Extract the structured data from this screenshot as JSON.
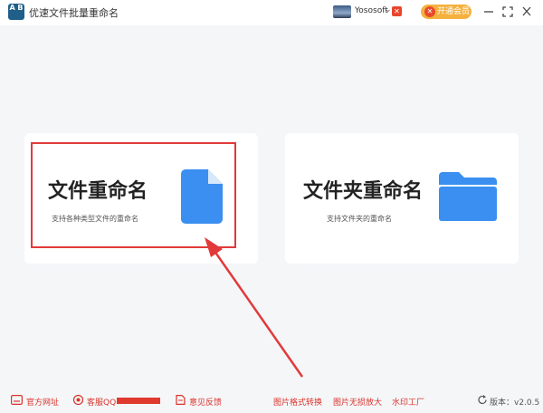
{
  "titlebar": {
    "title": "优速文件批量重命名",
    "logo_text": "A B",
    "username": "Yososoft",
    "user_caret": "⌄",
    "vip_label": "开通会员",
    "window_buttons": [
      "minimize-icon",
      "maximize-icon",
      "close-icon"
    ]
  },
  "cards": [
    {
      "title": "文件重命名",
      "description": "支持各种类型文件的重命名",
      "icon": "file-icon",
      "icon_color": "#3a8ff0"
    },
    {
      "title": "文件夹重命名",
      "description": "支持文件夹的重命名",
      "icon": "folder-icon",
      "icon_color": "#3a8ff0"
    }
  ],
  "annotation": {
    "highlight_color": "#e23a3a"
  },
  "footer": {
    "website": "官方网址",
    "support": "客服QQ",
    "feedback": "意见反馈",
    "format_convert": "图片格式转换",
    "lossless_zoom": "图片无损放大",
    "watermark": "水印工厂",
    "version": "版本：v2.0.5"
  }
}
